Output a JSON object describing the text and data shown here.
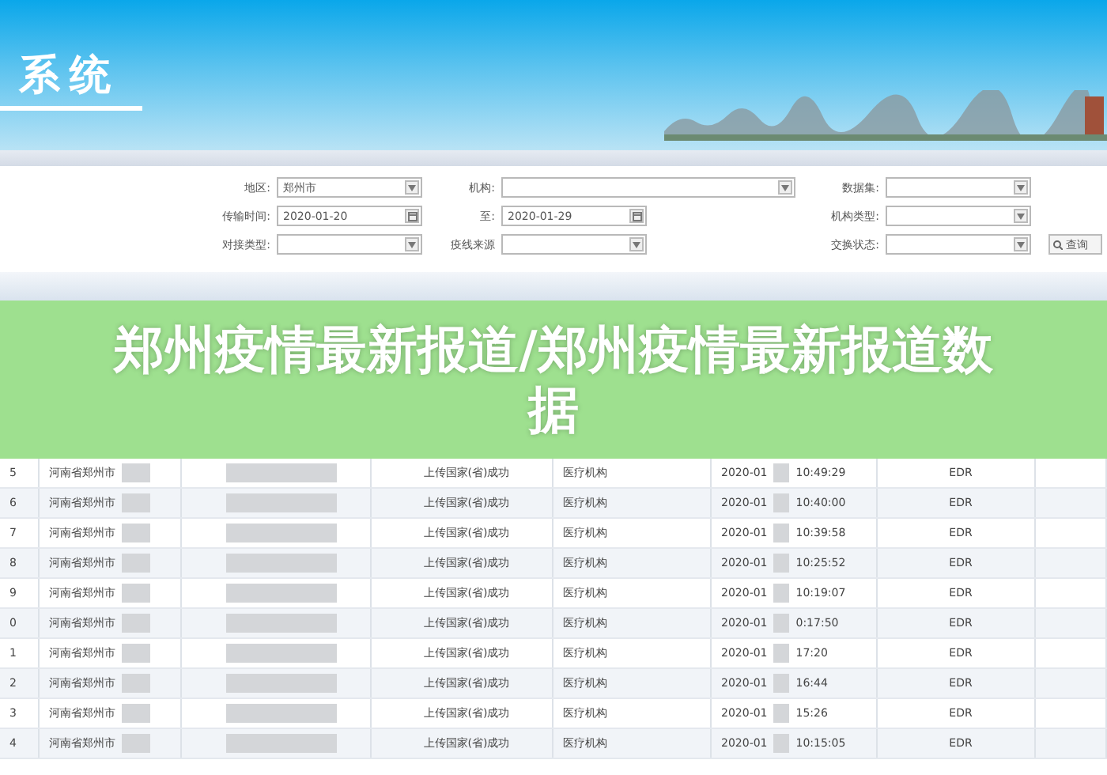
{
  "banner": {
    "title": "系统"
  },
  "filters": [
    [
      {
        "label": "地区:",
        "kind": "select",
        "value": "郑州市",
        "wide": false
      },
      {
        "label": "机构:",
        "kind": "select",
        "wide": true
      },
      {
        "label": "数据集:",
        "kind": "select",
        "wide": false
      }
    ],
    [
      {
        "label": "传输时间:",
        "kind": "date",
        "value": "2020-01-20",
        "wide": false
      },
      {
        "label": "至:",
        "kind": "date",
        "value": "2020-01-29",
        "wide": false
      },
      {
        "label": "机构类型:",
        "kind": "select",
        "wide": false
      }
    ],
    [
      {
        "label": "对接类型:",
        "kind": "select",
        "wide": false
      },
      {
        "label": "疫线来源",
        "kind": "select",
        "wide": false
      },
      {
        "label": "交换状态:",
        "kind": "select",
        "wide": false
      }
    ]
  ],
  "search_button": {
    "label": "查询"
  },
  "overlay": {
    "title": "郑州疫情最新报道/郑州疫情最新报道数据"
  },
  "table": {
    "rows": [
      {
        "number": "5",
        "region": "河南省郑州市",
        "status": "上传国家(省)成功",
        "type": "医疗机构",
        "date": "2020-01",
        "time": "10:49:29",
        "dataset": "EDR"
      },
      {
        "number": "6",
        "region": "河南省郑州市",
        "status": "上传国家(省)成功",
        "type": "医疗机构",
        "date": "2020-01",
        "time": "10:40:00",
        "dataset": "EDR"
      },
      {
        "number": "7",
        "region": "河南省郑州市",
        "status": "上传国家(省)成功",
        "type": "医疗机构",
        "date": "2020-01",
        "time": "10:39:58",
        "dataset": "EDR"
      },
      {
        "number": "8",
        "region": "河南省郑州市",
        "status": "上传国家(省)成功",
        "type": "医疗机构",
        "date": "2020-01",
        "time": "10:25:52",
        "dataset": "EDR"
      },
      {
        "number": "9",
        "region": "河南省郑州市",
        "status": "上传国家(省)成功",
        "type": "医疗机构",
        "date": "2020-01",
        "time": "10:19:07",
        "dataset": "EDR"
      },
      {
        "number": "0",
        "region": "河南省郑州市",
        "status": "上传国家(省)成功",
        "type": "医疗机构",
        "date": "2020-01",
        "time": "0:17:50",
        "dataset": "EDR"
      },
      {
        "number": "1",
        "region": "河南省郑州市",
        "status": "上传国家(省)成功",
        "type": "医疗机构",
        "date": "2020-01",
        "time": "17:20",
        "dataset": "EDR"
      },
      {
        "number": "2",
        "region": "河南省郑州市",
        "status": "上传国家(省)成功",
        "type": "医疗机构",
        "date": "2020-01",
        "time": "16:44",
        "dataset": "EDR"
      },
      {
        "number": "3",
        "region": "河南省郑州市",
        "status": "上传国家(省)成功",
        "type": "医疗机构",
        "date": "2020-01",
        "time": "15:26",
        "dataset": "EDR"
      },
      {
        "number": "4",
        "region": "河南省郑州市",
        "status": "上传国家(省)成功",
        "type": "医疗机构",
        "date": "2020-01",
        "time": "10:15:05",
        "dataset": "EDR"
      }
    ]
  }
}
